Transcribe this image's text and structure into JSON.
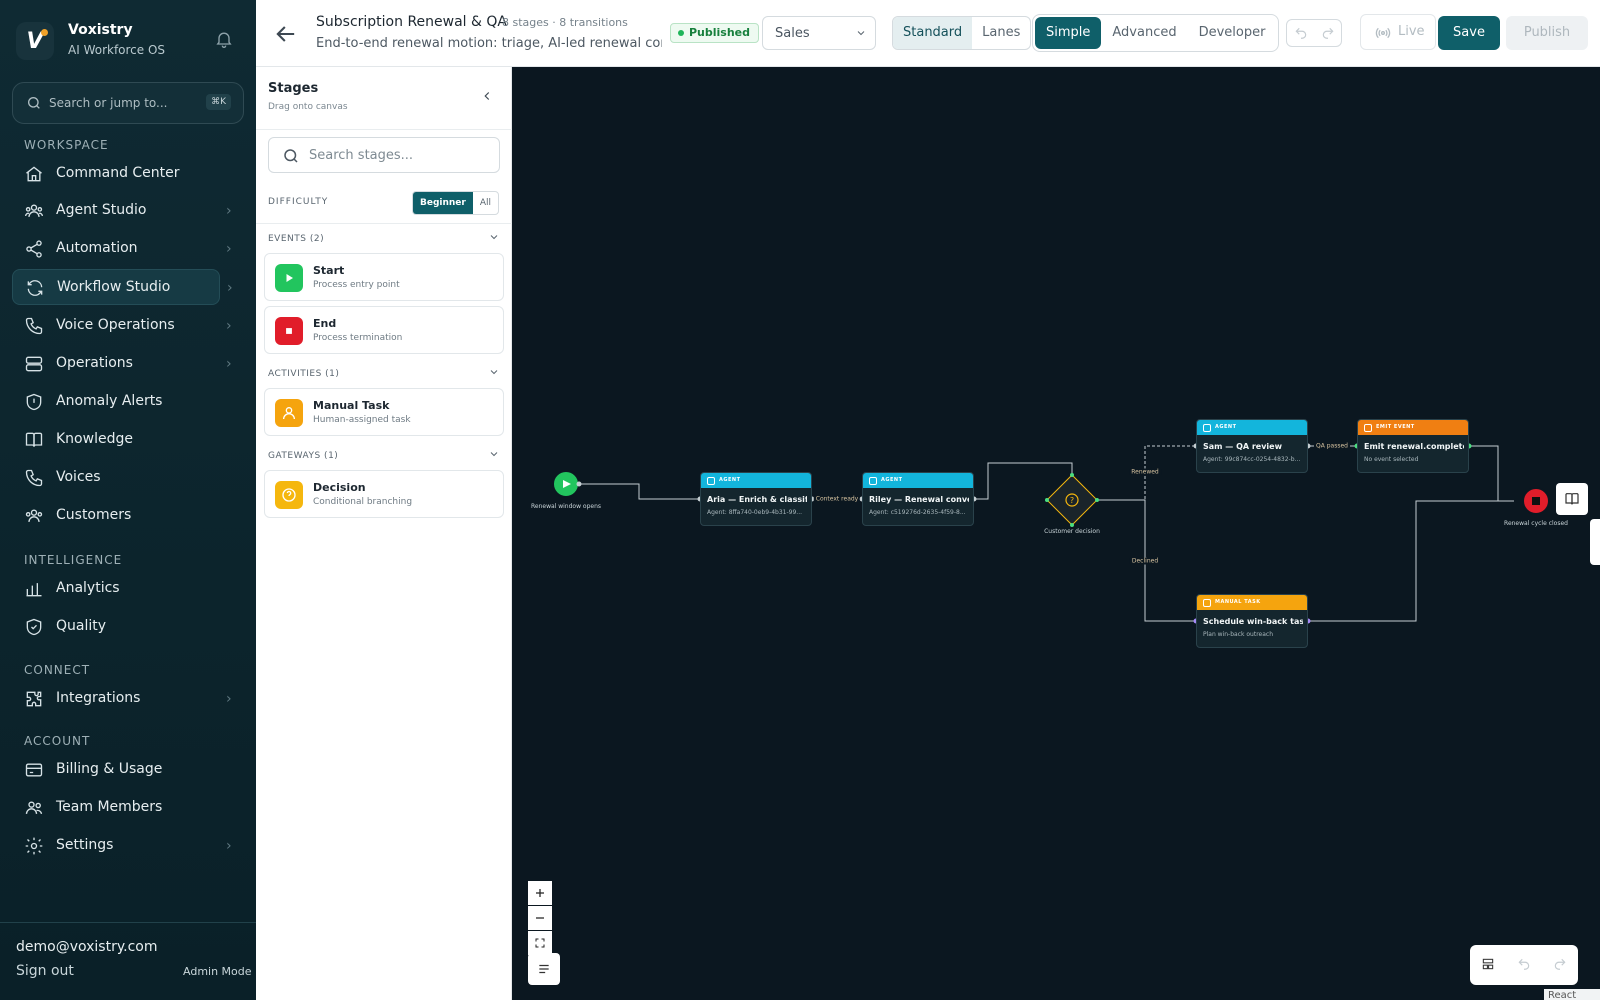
{
  "brand": {
    "name": "Voxistry",
    "tagline": "AI Workforce OS"
  },
  "search": {
    "placeholder": "Search or jump to...",
    "shortcut": "⌘K"
  },
  "sections": {
    "workspace": "WORKSPACE",
    "intelligence": "INTELLIGENCE",
    "connect": "CONNECT",
    "account": "ACCOUNT"
  },
  "nav": [
    {
      "label": "Command Center",
      "icon": "home-icon"
    },
    {
      "label": "Agent Studio",
      "icon": "agent-icon"
    },
    {
      "label": "Automation",
      "icon": "share-icon"
    },
    {
      "label": "Workflow Studio",
      "icon": "refresh-icon"
    },
    {
      "label": "Voice Operations",
      "icon": "phone-icon"
    },
    {
      "label": "Operations",
      "icon": "server-icon"
    },
    {
      "label": "Anomaly Alerts",
      "icon": "shield-icon"
    },
    {
      "label": "Knowledge",
      "icon": "book-icon"
    },
    {
      "label": "Voices",
      "icon": "phone-icon"
    },
    {
      "label": "Customers",
      "icon": "users-icon"
    },
    {
      "label": "Analytics",
      "icon": "bar-chart-icon"
    },
    {
      "label": "Quality",
      "icon": "shield-check-icon"
    },
    {
      "label": "Integrations",
      "icon": "puzzle-icon"
    },
    {
      "label": "Billing & Usage",
      "icon": "card-icon"
    },
    {
      "label": "Team Members",
      "icon": "team-icon"
    },
    {
      "label": "Settings",
      "icon": "gear-icon"
    }
  ],
  "footer": {
    "email": "demo@voxistry.com",
    "signout": "Sign out",
    "mode": "Admin Mode"
  },
  "workflow": {
    "title": "Subscription Renewal & QA",
    "meta": "8 stages · 8 transitions",
    "description": "End-to-end renewal motion: triage, AI-led renewal con",
    "status": "Published",
    "category": "Sales"
  },
  "toolbar": {
    "view_modes": [
      "Standard",
      "Lanes"
    ],
    "detail_modes": [
      "Simple",
      "Advanced",
      "Developer"
    ],
    "live": "Live",
    "save": "Save",
    "publish": "Publish"
  },
  "stages_panel": {
    "title": "Stages",
    "subtitle": "Drag onto canvas",
    "search_placeholder": "Search stages...",
    "difficulty_label": "DIFFICULTY",
    "difficulty_options": [
      "Beginner",
      "All"
    ],
    "groups": {
      "events": "EVENTS (2)",
      "activities": "ACTIVITIES (1)",
      "gateways": "GATEWAYS (1)"
    },
    "cards": {
      "start": {
        "title": "Start",
        "subtitle": "Process entry point"
      },
      "end": {
        "title": "End",
        "subtitle": "Process termination"
      },
      "manual": {
        "title": "Manual Task",
        "subtitle": "Human-assigned task"
      },
      "decision": {
        "title": "Decision",
        "subtitle": "Conditional branching"
      }
    }
  },
  "canvas": {
    "start_caption": "Renewal window opens",
    "end_caption": "Renewal cycle closed",
    "decision_caption": "Customer decision",
    "nodes": {
      "aria": {
        "type": "AGENT",
        "title": "Aria — Enrich & classify a...",
        "subtitle": "Agent: 8ffa740-0eb9-4b31-99..."
      },
      "riley": {
        "type": "AGENT",
        "title": "Riley — Renewal convers...",
        "subtitle": "Agent: c519276d-2635-4f59-8..."
      },
      "sam": {
        "type": "AGENT",
        "title": "Sam — QA review",
        "subtitle": "Agent: 99c874cc-0254-4832-b..."
      },
      "emit": {
        "type": "EMIT EVENT",
        "title": "Emit renewal.completed",
        "subtitle": "No event selected"
      },
      "winback": {
        "type": "MANUAL TASK",
        "title": "Schedule win-back task",
        "subtitle": "Plan win-back outreach"
      }
    },
    "edge_labels": {
      "context": "Context ready",
      "renewed": "Renewed",
      "declined": "Declined",
      "qa": "QA passed"
    },
    "colors": {
      "agent": "#13b5dc",
      "emit": "#f07f12",
      "manual": "#f5a40e",
      "start": "#22c55e",
      "end": "#e11d2a",
      "decision": "#f5b70e"
    },
    "watermark": "React Flow"
  }
}
